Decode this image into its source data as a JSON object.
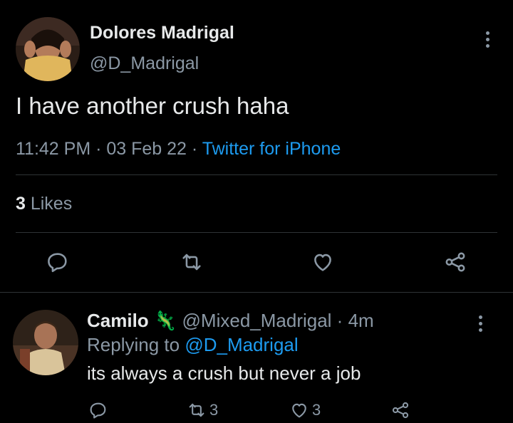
{
  "main_tweet": {
    "author_name": "Dolores Madrigal",
    "author_handle": "@D_Madrigal",
    "text": "I have another crush haha",
    "time": "11:42 PM",
    "separator1": " · ",
    "date": "03 Feb 22",
    "separator2": " · ",
    "source": "Twitter for iPhone",
    "likes_count": "3",
    "likes_label": " Likes"
  },
  "reply_tweet": {
    "author_name": "Camilo",
    "emoji": "🦎",
    "author_handle": "@Mixed_Madrigal",
    "separator": " · ",
    "age": "4m",
    "replying_prefix": "Replying to ",
    "replying_to": "@D_Madrigal",
    "text": "its always a crush but never a job",
    "retweet_count": "3",
    "like_count": "3"
  },
  "icons": {
    "reply": "reply-icon",
    "retweet": "retweet-icon",
    "like": "heart-icon",
    "share": "share-icon",
    "more": "more-vertical-icon"
  },
  "colors": {
    "background": "#000000",
    "text": "#e7e9ea",
    "secondary": "#8b98a5",
    "accent": "#1d9bf0",
    "divider": "#2f3336"
  }
}
